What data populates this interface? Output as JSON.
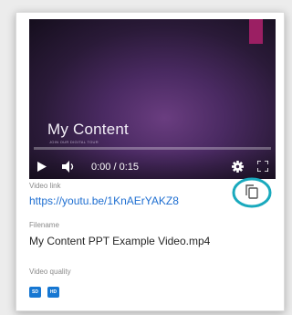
{
  "video": {
    "title": "My Content",
    "subtitle": "JOIN OUR DIGITAL TOUR",
    "time": "0:00 / 0:15",
    "progress": 0,
    "accent_color": "#9b1f63",
    "controls": [
      "play-icon",
      "volume-icon",
      "gear-icon",
      "fullscreen-icon"
    ]
  },
  "link": {
    "label": "Video link",
    "url": "https://youtu.be/1KnAErYAKZ8",
    "copy_icon": "copy-icon",
    "highlight_color": "#19a9bd"
  },
  "file": {
    "label": "Filename",
    "name": "My Content PPT Example Video.mp4"
  },
  "quality": {
    "label": "Video quality",
    "badges": [
      "SD",
      "HD"
    ],
    "badge_color": "#1677d2"
  }
}
